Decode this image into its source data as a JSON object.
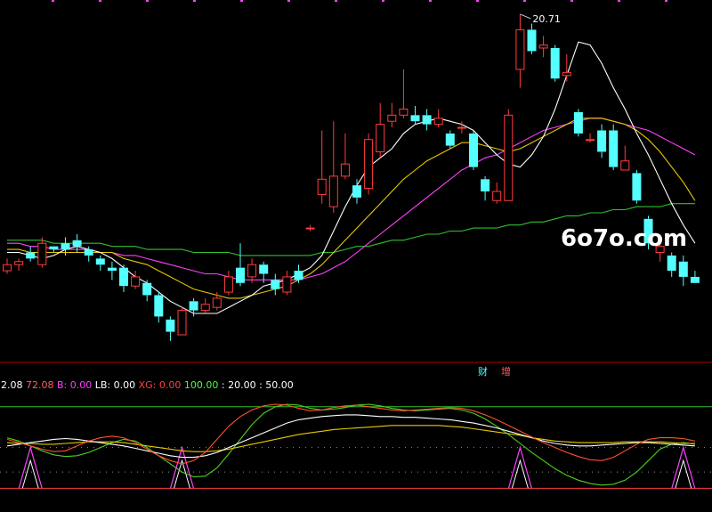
{
  "watermark": "6o7o.com",
  "max_price_label": "20.71",
  "tags": [
    "财",
    "增"
  ],
  "indicator_readout": [
    {
      "text": "2.08",
      "color": "#ffffff"
    },
    {
      "text": "72.08",
      "color": "#ff6060"
    },
    {
      "text": "B: 0.00",
      "color": "#ff40ff"
    },
    {
      "text": "LB: 0.00",
      "color": "#ffffff"
    },
    {
      "text": "XG: 0.00",
      "color": "#ff4040"
    },
    {
      "text": "100.00",
      "color": "#40ff40"
    },
    {
      "text": ": 20.00",
      "color": "#ffffff"
    },
    {
      "text": ": 50.00",
      "color": "#ffffff"
    }
  ],
  "colors": {
    "up": "#ff3c3c",
    "down": "#54ffff",
    "ma5": "#ffffff",
    "ma10": "#e8c800",
    "ma20": "#ff40ff",
    "ma60": "#30c030"
  },
  "chart_data": [
    {
      "type": "candlestick",
      "ylim": [
        9.5,
        21.0
      ],
      "max_label": "20.71",
      "candles": [
        [
          12.3,
          12.5,
          12.7,
          12.2
        ],
        [
          12.5,
          12.6,
          12.7,
          12.3
        ],
        [
          12.9,
          12.7,
          13.1,
          12.6
        ],
        [
          12.5,
          13.2,
          13.4,
          12.4
        ],
        [
          13.1,
          13.0,
          13.1,
          12.9
        ],
        [
          13.2,
          13.0,
          13.4,
          12.8
        ],
        [
          13.3,
          13.1,
          13.5,
          12.9
        ],
        [
          13.0,
          12.8,
          13.1,
          12.6
        ],
        [
          12.7,
          12.5,
          12.8,
          12.3
        ],
        [
          12.4,
          12.3,
          12.6,
          12.0
        ],
        [
          12.4,
          11.8,
          12.5,
          11.6
        ],
        [
          11.8,
          12.1,
          12.3,
          11.7
        ],
        [
          11.9,
          11.5,
          12.0,
          11.3
        ],
        [
          11.5,
          10.8,
          11.6,
          10.6
        ],
        [
          10.7,
          10.3,
          10.8,
          10.0
        ],
        [
          10.2,
          11.0,
          11.1,
          10.2
        ],
        [
          11.3,
          11.0,
          11.4,
          10.8
        ],
        [
          11.0,
          11.2,
          11.4,
          10.9
        ],
        [
          11.1,
          11.4,
          11.6,
          11.0
        ],
        [
          11.6,
          12.1,
          12.3,
          11.5
        ],
        [
          12.4,
          11.9,
          13.2,
          11.8
        ],
        [
          12.1,
          12.5,
          12.7,
          11.9
        ],
        [
          12.5,
          12.2,
          12.6,
          11.9
        ],
        [
          12.0,
          11.7,
          12.2,
          11.5
        ],
        [
          11.6,
          12.1,
          12.3,
          11.5
        ],
        [
          12.3,
          12.0,
          12.5,
          11.9
        ],
        [
          13.7,
          13.7,
          13.8,
          13.6
        ],
        [
          14.8,
          15.3,
          16.9,
          14.5
        ],
        [
          14.4,
          15.4,
          17.2,
          14.2
        ],
        [
          15.4,
          15.8,
          16.8,
          15.3
        ],
        [
          15.1,
          14.7,
          15.3,
          14.5
        ],
        [
          15.0,
          16.6,
          16.8,
          14.8
        ],
        [
          16.2,
          17.1,
          17.8,
          16.0
        ],
        [
          17.2,
          17.4,
          17.8,
          17.0
        ],
        [
          17.4,
          17.6,
          18.9,
          17.3
        ],
        [
          17.4,
          17.2,
          17.7,
          17.1
        ],
        [
          17.4,
          17.1,
          17.6,
          16.9
        ],
        [
          17.1,
          17.3,
          17.6,
          17.0
        ],
        [
          16.8,
          16.4,
          16.9,
          16.3
        ],
        [
          17.0,
          17.0,
          17.2,
          16.8
        ],
        [
          16.8,
          15.7,
          16.9,
          15.6
        ],
        [
          15.3,
          14.9,
          15.4,
          14.6
        ],
        [
          14.6,
          14.9,
          15.2,
          14.5
        ],
        [
          14.6,
          17.4,
          17.6,
          14.6
        ],
        [
          18.9,
          20.2,
          20.71,
          18.3
        ],
        [
          20.2,
          19.5,
          20.4,
          19.4
        ],
        [
          19.6,
          19.7,
          20.0,
          19.3
        ],
        [
          19.6,
          18.6,
          19.7,
          18.5
        ],
        [
          18.7,
          18.8,
          19.4,
          18.5
        ],
        [
          17.5,
          16.8,
          17.6,
          16.7
        ],
        [
          16.6,
          16.6,
          16.8,
          16.5
        ],
        [
          16.9,
          16.2,
          17.1,
          16.0
        ],
        [
          16.9,
          15.7,
          17.1,
          15.6
        ],
        [
          15.6,
          15.9,
          16.4,
          15.8
        ],
        [
          15.5,
          14.6,
          15.6,
          14.5
        ],
        [
          14.0,
          13.2,
          14.1,
          13.0
        ],
        [
          12.9,
          13.1,
          13.2,
          12.6
        ],
        [
          12.8,
          12.3,
          12.9,
          12.1
        ],
        [
          12.6,
          12.1,
          12.8,
          11.8
        ],
        [
          12.1,
          11.9,
          12.3,
          11.9
        ]
      ],
      "ma5": [
        12.9,
        12.9,
        12.8,
        12.7,
        12.8,
        13.0,
        13.1,
        13.0,
        12.9,
        12.7,
        12.4,
        12.1,
        11.9,
        11.6,
        11.3,
        11.1,
        10.9,
        10.9,
        10.9,
        11.1,
        11.3,
        11.5,
        11.8,
        11.9,
        12.0,
        12.2,
        12.4,
        12.8,
        13.6,
        14.4,
        15.1,
        15.7,
        16.0,
        16.3,
        16.8,
        17.1,
        17.2,
        17.3,
        17.2,
        17.1,
        16.9,
        16.5,
        16.1,
        15.8,
        15.7,
        16.1,
        16.7,
        17.6,
        18.7,
        19.8,
        19.7,
        19.1,
        18.3,
        17.6,
        16.8,
        16.1,
        15.3,
        14.5,
        13.8,
        13.2
      ],
      "ma10": [
        13.0,
        13.0,
        12.9,
        12.9,
        12.9,
        12.9,
        12.9,
        12.9,
        12.9,
        12.9,
        12.7,
        12.6,
        12.5,
        12.3,
        12.1,
        11.9,
        11.7,
        11.6,
        11.5,
        11.4,
        11.4,
        11.5,
        11.6,
        11.7,
        11.8,
        12.0,
        12.2,
        12.5,
        12.9,
        13.3,
        13.7,
        14.1,
        14.5,
        14.9,
        15.3,
        15.6,
        15.9,
        16.1,
        16.3,
        16.5,
        16.5,
        16.4,
        16.3,
        16.2,
        16.3,
        16.5,
        16.7,
        16.9,
        17.1,
        17.3,
        17.3,
        17.3,
        17.2,
        17.1,
        16.9,
        16.6,
        16.2,
        15.7,
        15.2,
        14.6
      ],
      "ma20": [
        13.2,
        13.2,
        13.1,
        13.1,
        13.0,
        13.0,
        13.0,
        13.0,
        12.9,
        12.9,
        12.8,
        12.8,
        12.7,
        12.6,
        12.5,
        12.4,
        12.3,
        12.2,
        12.2,
        12.1,
        12.0,
        12.0,
        12.0,
        12.0,
        12.0,
        12.0,
        12.1,
        12.2,
        12.4,
        12.6,
        12.9,
        13.2,
        13.5,
        13.8,
        14.1,
        14.4,
        14.7,
        15.0,
        15.3,
        15.6,
        15.8,
        16.0,
        16.1,
        16.3,
        16.5,
        16.7,
        16.9,
        17.0,
        17.1,
        17.2,
        17.3,
        17.3,
        17.2,
        17.1,
        17.0,
        16.9,
        16.7,
        16.5,
        16.3,
        16.1
      ],
      "ma60": [
        13.3,
        13.3,
        13.3,
        13.3,
        13.2,
        13.2,
        13.2,
        13.2,
        13.2,
        13.1,
        13.1,
        13.1,
        13.0,
        13.0,
        13.0,
        13.0,
        12.9,
        12.9,
        12.9,
        12.9,
        12.8,
        12.8,
        12.8,
        12.8,
        12.8,
        12.8,
        12.8,
        12.9,
        12.9,
        13.0,
        13.1,
        13.1,
        13.2,
        13.3,
        13.3,
        13.4,
        13.5,
        13.5,
        13.6,
        13.6,
        13.7,
        13.7,
        13.7,
        13.8,
        13.8,
        13.9,
        13.9,
        14.0,
        14.1,
        14.1,
        14.2,
        14.2,
        14.3,
        14.3,
        14.4,
        14.4,
        14.4,
        14.5,
        14.5,
        14.5
      ]
    },
    {
      "type": "line",
      "ylim": [
        -5,
        115
      ],
      "ref_levels": [
        100,
        50,
        20,
        0
      ],
      "series": {
        "orange": [
          60,
          56,
          52,
          48,
          45,
          46,
          52,
          58,
          62,
          64,
          62,
          56,
          48,
          40,
          34,
          30,
          34,
          44,
          60,
          76,
          88,
          96,
          101,
          103,
          102,
          98,
          95,
          96,
          99,
          101,
          102,
          100,
          98,
          96,
          95,
          96,
          97,
          98,
          99,
          98,
          95,
          90,
          84,
          77,
          70,
          63,
          56,
          50,
          44,
          39,
          35,
          34,
          38,
          46,
          54,
          60,
          62,
          62,
          61,
          58
        ],
        "white": [
          52,
          54,
          56,
          58,
          60,
          61,
          60,
          58,
          56,
          54,
          52,
          49,
          46,
          43,
          40,
          38,
          38,
          40,
          44,
          50,
          56,
          62,
          68,
          74,
          80,
          84,
          86,
          88,
          89,
          90,
          90,
          89,
          88,
          88,
          87,
          87,
          86,
          85,
          84,
          82,
          80,
          77,
          74,
          70,
          66,
          62,
          58,
          55,
          53,
          52,
          52,
          53,
          54,
          55,
          56,
          56,
          55,
          54,
          53,
          52
        ],
        "yellow": [
          56,
          55,
          55,
          54,
          54,
          55,
          56,
          57,
          57,
          57,
          56,
          54,
          52,
          50,
          48,
          46,
          45,
          45,
          46,
          48,
          51,
          54,
          57,
          60,
          63,
          66,
          68,
          70,
          72,
          73,
          74,
          75,
          76,
          77,
          77,
          77,
          77,
          77,
          76,
          75,
          73,
          71,
          69,
          67,
          65,
          62,
          60,
          58,
          57,
          56,
          56,
          56,
          56,
          57,
          57,
          57,
          57,
          56,
          55,
          55
        ],
        "green": [
          62,
          58,
          52,
          46,
          41,
          39,
          40,
          44,
          50,
          56,
          60,
          58,
          50,
          40,
          30,
          20,
          14,
          15,
          25,
          42,
          60,
          78,
          92,
          100,
          103,
          102,
          98,
          96,
          97,
          99,
          102,
          103,
          101,
          98,
          96,
          95,
          96,
          97,
          98,
          96,
          92,
          85,
          76,
          66,
          55,
          44,
          34,
          24,
          16,
          10,
          6,
          4,
          5,
          10,
          20,
          34,
          48,
          54,
          56,
          54
        ],
        "triangles": [
          2,
          15,
          44,
          58
        ]
      }
    }
  ]
}
